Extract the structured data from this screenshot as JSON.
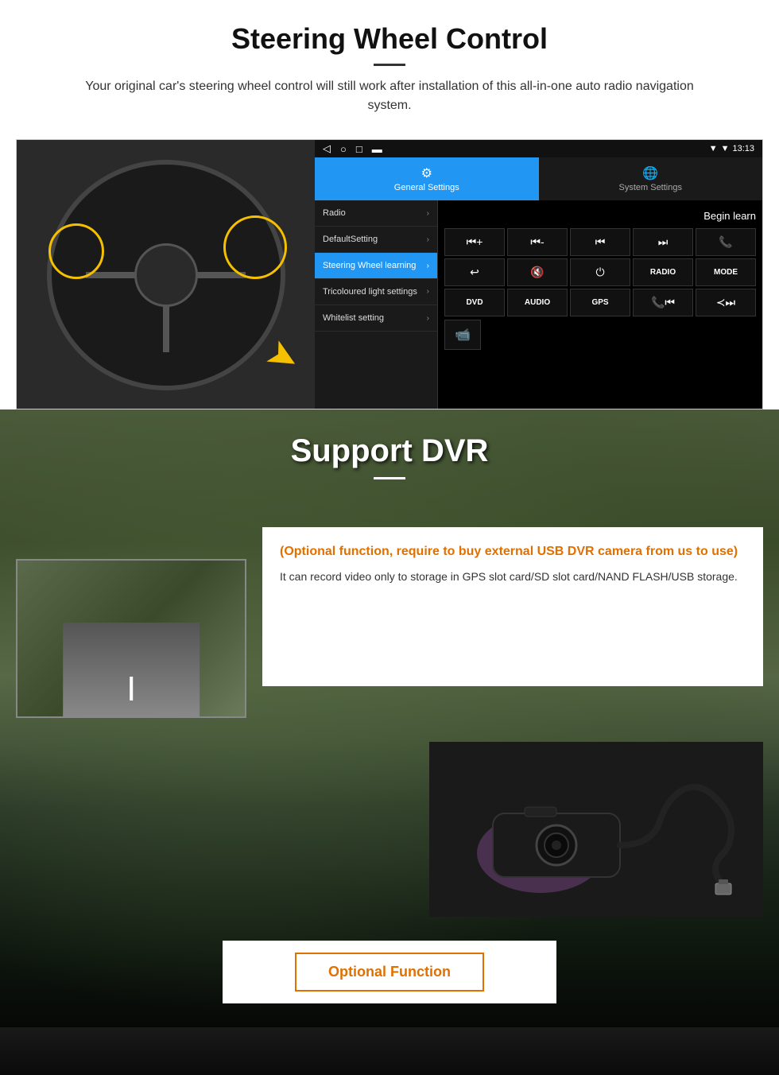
{
  "section1": {
    "title": "Steering Wheel Control",
    "subtitle": "Your original car's steering wheel control will still work after installation of this all-in-one auto radio navigation system.",
    "statusbar": {
      "time": "13:13",
      "icons": "▼ ▼"
    },
    "nav_icons": [
      "◁",
      "○",
      "□",
      "▬"
    ],
    "tabs": {
      "general": {
        "label": "General Settings",
        "icon": "⚙"
      },
      "system": {
        "label": "System Settings",
        "icon": "🌐"
      }
    },
    "menu_items": [
      {
        "label": "Radio",
        "active": false
      },
      {
        "label": "DefaultSetting",
        "active": false
      },
      {
        "label": "Steering Wheel learning",
        "active": true
      },
      {
        "label": "Tricoloured light settings",
        "active": false
      },
      {
        "label": "Whitelist setting",
        "active": false
      }
    ],
    "begin_learn": "Begin learn",
    "control_buttons": [
      {
        "label": "⏮+",
        "type": "icon"
      },
      {
        "label": "⏮-",
        "type": "icon"
      },
      {
        "label": "⏮",
        "type": "icon"
      },
      {
        "label": "⏭",
        "type": "icon"
      },
      {
        "label": "📞",
        "type": "icon"
      },
      {
        "label": "↩",
        "type": "icon"
      },
      {
        "label": "🔇",
        "type": "icon"
      },
      {
        "label": "⏻",
        "type": "icon"
      },
      {
        "label": "RADIO",
        "type": "text"
      },
      {
        "label": "MODE",
        "type": "text"
      },
      {
        "label": "DVD",
        "type": "text"
      },
      {
        "label": "AUDIO",
        "type": "text"
      },
      {
        "label": "GPS",
        "type": "text"
      },
      {
        "label": "📞⏮",
        "type": "icon"
      },
      {
        "label": "≺⏭",
        "type": "icon"
      }
    ],
    "dvr_icon": "📹"
  },
  "section2": {
    "title": "Support DVR",
    "optional_text": "(Optional function, require to buy external USB DVR camera from us to use)",
    "description": "It can record video only to storage in GPS slot card/SD slot card/NAND FLASH/USB storage.",
    "optional_function_btn": "Optional Function"
  }
}
